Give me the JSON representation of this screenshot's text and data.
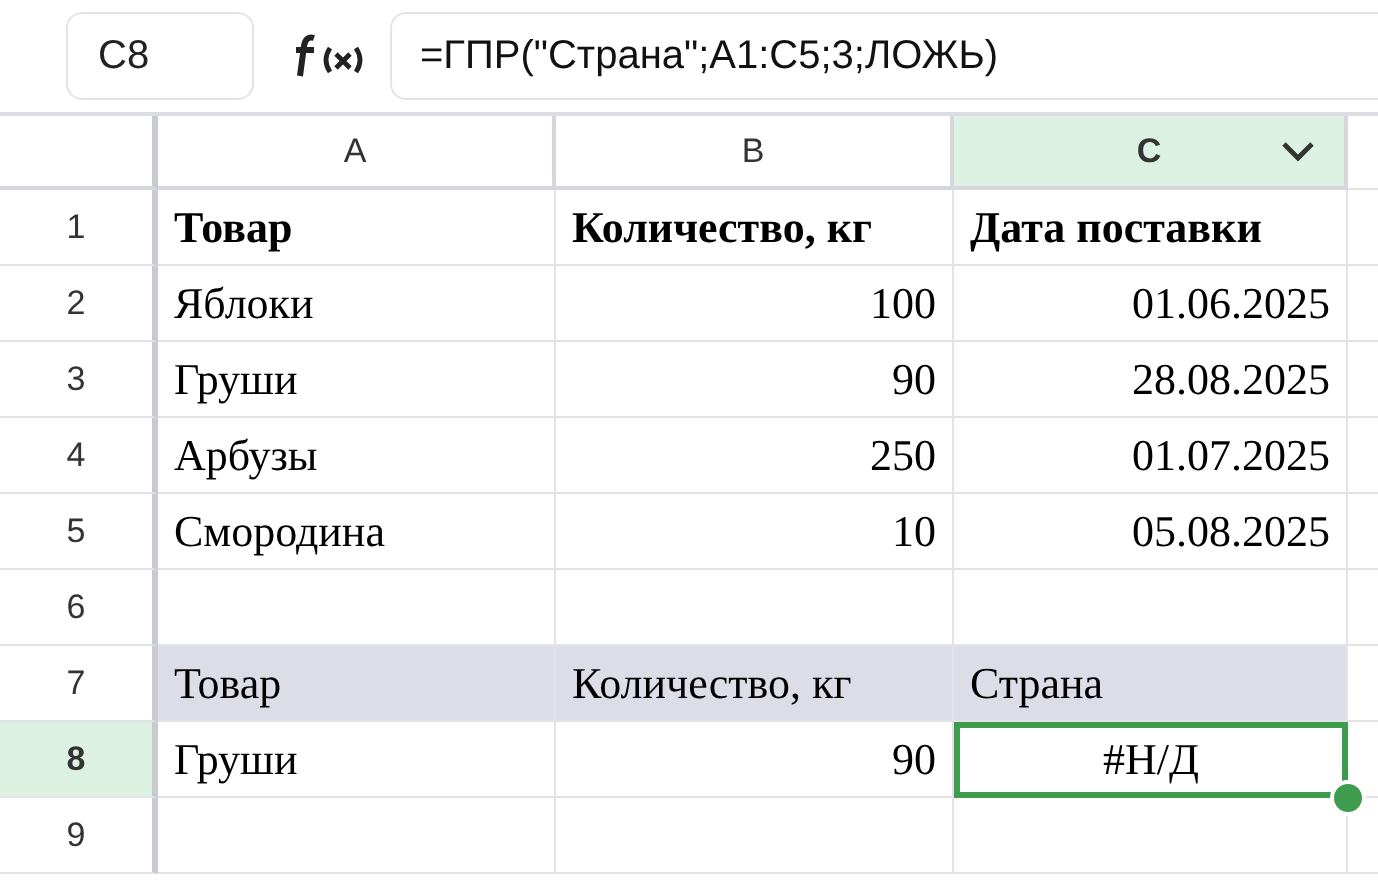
{
  "name_box": {
    "value": "C8"
  },
  "formula_bar": {
    "value": "=ГПР(\"Страна\";A1:C5;3;ЛОЖЬ)"
  },
  "columns": [
    {
      "label": "A",
      "selected": false
    },
    {
      "label": "B",
      "selected": false
    },
    {
      "label": "C",
      "selected": true
    }
  ],
  "rows": [
    {
      "number": "1",
      "selected": false,
      "bold": true,
      "shaded": false,
      "cells": [
        {
          "kind": "text",
          "text": "Товар"
        },
        {
          "kind": "text",
          "text": "Количество, кг"
        },
        {
          "kind": "text",
          "text": "Дата поставки"
        }
      ]
    },
    {
      "number": "2",
      "selected": false,
      "bold": false,
      "shaded": false,
      "cells": [
        {
          "kind": "text",
          "text": "Яблоки"
        },
        {
          "kind": "number",
          "text": "100"
        },
        {
          "kind": "date",
          "text": "01.06.2025"
        }
      ]
    },
    {
      "number": "3",
      "selected": false,
      "bold": false,
      "shaded": false,
      "cells": [
        {
          "kind": "text",
          "text": "Груши"
        },
        {
          "kind": "number",
          "text": "90"
        },
        {
          "kind": "date",
          "text": "28.08.2025"
        }
      ]
    },
    {
      "number": "4",
      "selected": false,
      "bold": false,
      "shaded": false,
      "cells": [
        {
          "kind": "text",
          "text": "Арбузы"
        },
        {
          "kind": "number",
          "text": "250"
        },
        {
          "kind": "date",
          "text": "01.07.2025"
        }
      ]
    },
    {
      "number": "5",
      "selected": false,
      "bold": false,
      "shaded": false,
      "cells": [
        {
          "kind": "text",
          "text": "Смородина"
        },
        {
          "kind": "number",
          "text": "10"
        },
        {
          "kind": "date",
          "text": "05.08.2025"
        }
      ]
    },
    {
      "number": "6",
      "selected": false
    },
    {
      "number": "7",
      "selected": false,
      "bold": false,
      "shaded": true,
      "cells": [
        {
          "kind": "text",
          "text": "Товар"
        },
        {
          "kind": "text",
          "text": "Количество, кг"
        },
        {
          "kind": "text",
          "text": "Страна"
        }
      ]
    },
    {
      "number": "8",
      "selected": true,
      "bold": false,
      "shaded": false,
      "cells": [
        {
          "kind": "text",
          "text": "Груши",
          "selected": false
        },
        {
          "kind": "number",
          "text": "90",
          "selected": false
        },
        {
          "kind": "error",
          "text": "#Н/Д",
          "selected": true
        }
      ]
    },
    {
      "number": "9",
      "selected": false
    }
  ]
}
